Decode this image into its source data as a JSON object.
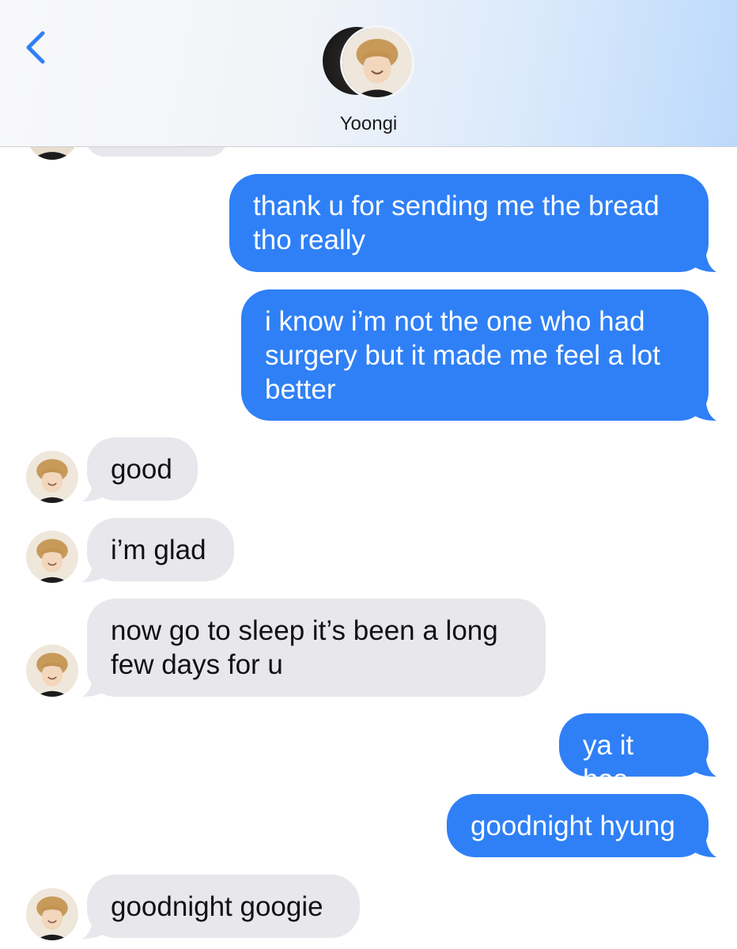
{
  "header": {
    "contact_name": "Yoongi",
    "back_icon": "chevron-left-icon",
    "accent_color": "#2f80f6"
  },
  "messages": [
    {
      "sender": "me",
      "text": "thank u for sending me the bread\ntho really"
    },
    {
      "sender": "me",
      "text": "i know i’m not the one who had\nsurgery but it made me feel a lot\nbetter"
    },
    {
      "sender": "them",
      "text": "good"
    },
    {
      "sender": "them",
      "text": "i’m glad"
    },
    {
      "sender": "them",
      "text": "now go to sleep it’s been a long\nfew days for u"
    },
    {
      "sender": "me",
      "text": "ya it has"
    },
    {
      "sender": "me",
      "text": "goodnight hyung"
    },
    {
      "sender": "them",
      "text": "goodnight googie"
    }
  ],
  "colors": {
    "sent_bubble": "#2f80f6",
    "received_bubble": "#e7e7ec"
  }
}
